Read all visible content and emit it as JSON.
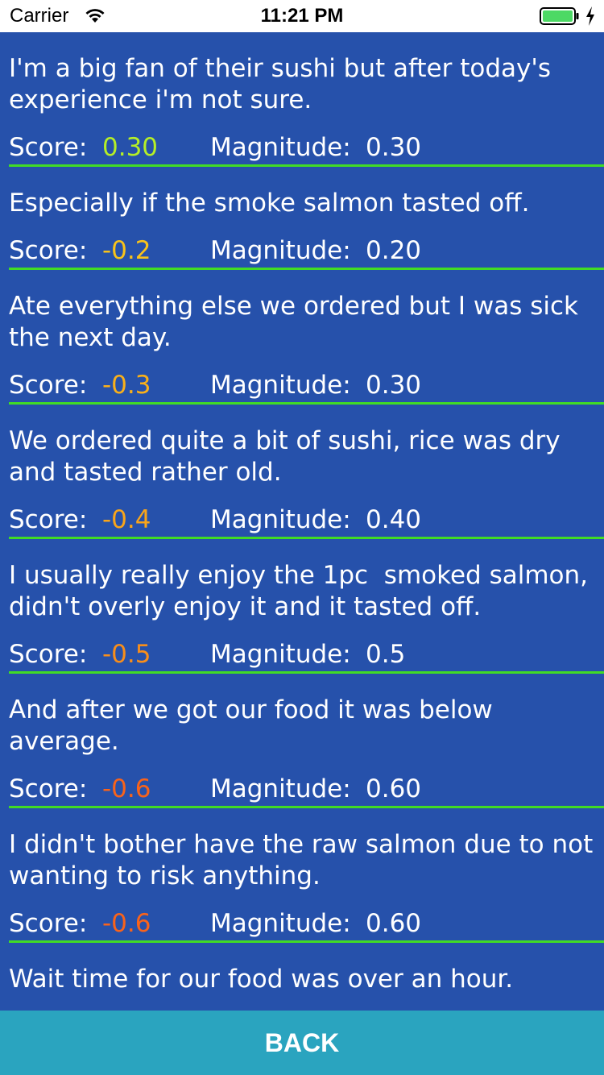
{
  "status_bar": {
    "carrier": "Carrier",
    "time": "11:21 PM",
    "icons": [
      "wifi-icon",
      "battery-icon",
      "charging-bolt-icon"
    ],
    "battery_color": "#4cd964"
  },
  "colors": {
    "content_background": "#2651ab",
    "divider": "#41dc25",
    "back_button_background": "#2aa4bf"
  },
  "labels": {
    "score": "Score:",
    "magnitude": "Magnitude:"
  },
  "items": [
    {
      "text": "I'm a big fan of their sushi but after today's experience i'm not sure.",
      "score": "0.30",
      "score_color": "#b5ef27",
      "magnitude": "0.30"
    },
    {
      "text": "Especially if the smoke salmon tasted off.",
      "score": "-0.2",
      "score_color": "#f9c31a",
      "magnitude": "0.20"
    },
    {
      "text": "Ate everything else we ordered but I was sick the next day.",
      "score": "-0.3",
      "score_color": "#f9b01a",
      "magnitude": "0.30"
    },
    {
      "text": "We ordered quite a bit of sushi, rice was dry and tasted rather old.",
      "score": "-0.4",
      "score_color": "#f9a51a",
      "magnitude": "0.40"
    },
    {
      "text": "I usually really enjoy the 1pc  smoked salmon, didn't overly enjoy it and it tasted off.",
      "score": "-0.5",
      "score_color": "#f98e1a",
      "magnitude": "0.5"
    },
    {
      "text": "And after we got our food it was below average.",
      "score": "-0.6",
      "score_color": "#f9631a",
      "magnitude": "0.60"
    },
    {
      "text": "I didn't bother have the raw salmon due to not wanting to risk anything.",
      "score": "-0.6",
      "score_color": "#f9631a",
      "magnitude": "0.60"
    },
    {
      "text": "Wait time for our food was over an hour.",
      "score": "",
      "score_color": "#f9631a",
      "magnitude": ""
    }
  ],
  "back_button": {
    "label": "BACK"
  }
}
